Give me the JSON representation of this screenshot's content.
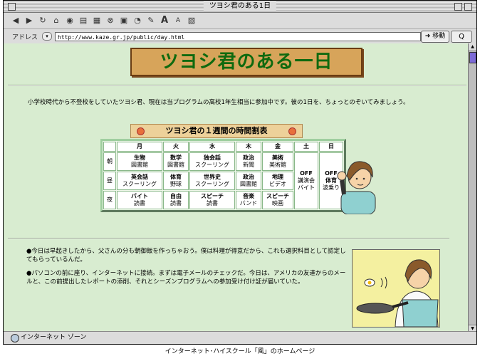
{
  "window": {
    "title": "ツヨシ君のある1日"
  },
  "toolbar": {
    "icons": [
      "back-icon",
      "forward-icon",
      "reload-icon",
      "home-icon",
      "favorites-icon",
      "history-icon",
      "print-icon",
      "stop-icon",
      "folder-icon",
      "autofill-icon",
      "edit-icon",
      "font-larger-icon",
      "font-smaller-icon",
      "search-folder-icon"
    ]
  },
  "address": {
    "label": "アドレス",
    "url": "http://www.kaze.gr.jp/public/day.html",
    "go_label": "移動",
    "find_glyph": "Q"
  },
  "page": {
    "logo": "ツヨシ君のある一日",
    "intro": "小学校時代から不登校をしていたツヨシ君、現在は当プログラムの高校1年生相当に参加中です。彼の1日を、ちょっとのぞいてみましょう。",
    "timetable_title": "ツヨシ君の１週間の時間割表",
    "timetable": {
      "days": [
        "月",
        "火",
        "水",
        "木",
        "金",
        "土",
        "日"
      ],
      "slots": [
        "朝",
        "昼",
        "夜"
      ],
      "morning": [
        [
          "生物",
          "図書館"
        ],
        [
          "数学",
          "図書館"
        ],
        [
          "独会話",
          "スクーリング"
        ],
        [
          "政治",
          "新聞"
        ],
        [
          "美術",
          "美術館"
        ]
      ],
      "noon": [
        [
          "英会話",
          "スクーリング"
        ],
        [
          "体育",
          "野球"
        ],
        [
          "世界史",
          "スクーリング"
        ],
        [
          "政治",
          "図書館"
        ],
        [
          "地理",
          "ビデオ"
        ]
      ],
      "night": [
        [
          "バイト",
          "読書"
        ],
        [
          "自由",
          "読書"
        ],
        [
          "スピーチ",
          "読書"
        ],
        [
          "音楽",
          "バンド"
        ],
        [
          "スピーチ",
          "映画"
        ]
      ],
      "saturday": [
        "OFF",
        "講演会",
        "バイト"
      ],
      "sunday": [
        "OFF",
        "体育",
        "波乗り"
      ]
    },
    "bullet1": "●今日は早起きしたから、父さんの分も朝御飯を作っちゃおう。僕は料理が得意だから、これも選択科目として認定してもらっているんだ。",
    "bullet2": "●パソコンの前に座り、インターネットに接続。まずは電子メールのチェックだ。今日は、アメリカの友達からのメールと、この前提出したレポートの添削、それとシーズンプログラムへの参加受け付け証が届いていた。"
  },
  "status": {
    "text": "インターネット ゾーン"
  },
  "caption": "インターネット･ハイスクール「風」のホームページ",
  "colors": {
    "page_bg": "#d8ecd0",
    "logo_bg": "#d7a45a",
    "logo_text": "#0f6a0f",
    "title_bg": "#edd19a"
  }
}
